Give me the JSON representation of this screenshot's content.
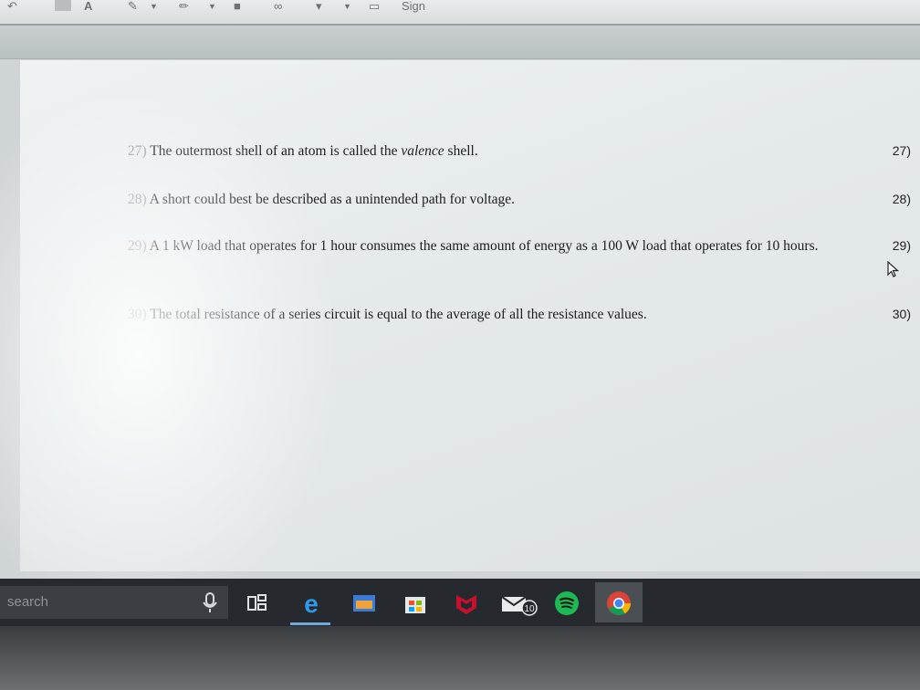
{
  "toolbar": {
    "sign_label": "Sign"
  },
  "questions": [
    {
      "num": "27)",
      "text_before": "The outermost shell of an atom is called the ",
      "text_italic": "valence",
      "text_after": " shell.",
      "answer_num": "27)"
    },
    {
      "num": "28)",
      "text": "A short could best be described as a unintended path for voltage.",
      "answer_num": "28)"
    },
    {
      "num": "29)",
      "text": "A 1 kW load that operates for 1 hour consumes the same amount of energy as a 100 W load that operates for 10 hours.",
      "answer_num": "29)"
    },
    {
      "num": "30)",
      "text": "The total resistance of a series circuit is equal to the average of all the resistance values.",
      "answer_num": "30)"
    }
  ],
  "taskbar": {
    "search_text": "search",
    "mail_badge": "10",
    "icons": [
      "microphone-icon",
      "task-view-icon",
      "edge-icon",
      "photos-icon",
      "store-icon",
      "mcafee-icon",
      "mail-icon",
      "spotify-icon",
      "chrome-icon"
    ]
  }
}
